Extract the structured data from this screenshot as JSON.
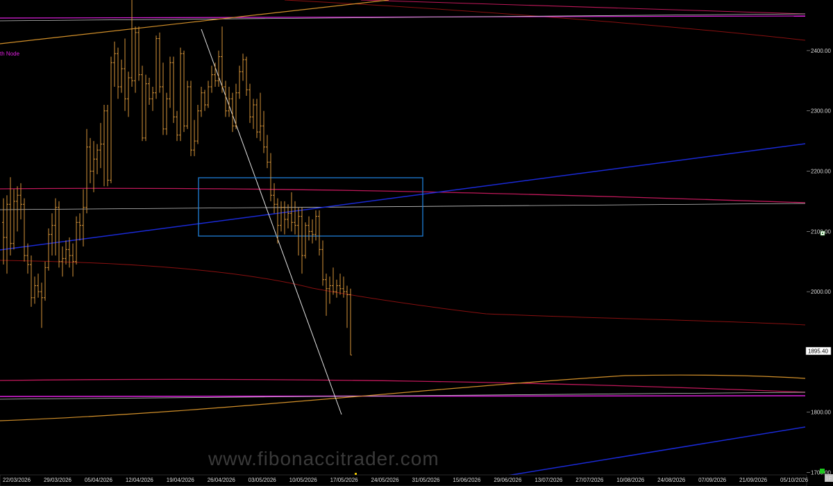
{
  "chart_data": {
    "type": "ohlc",
    "y_axis": {
      "ylim": [
        1696,
        2484
      ],
      "ticks": [
        "2400.00",
        "2300.00",
        "2200.00",
        "2100.00",
        "2000.00",
        "1900.00",
        "1800.00",
        "1700.00"
      ],
      "tick_values": [
        2400,
        2300,
        2200,
        2100,
        2000,
        1900,
        1800,
        1700
      ]
    },
    "x_axis": {
      "ticks": [
        "22/03/2026",
        "29/03/2026",
        "05/04/2026",
        "12/04/2026",
        "19/04/2026",
        "26/04/2026",
        "03/05/2026",
        "10/05/2026",
        "17/05/2026",
        "24/05/2026",
        "31/05/2026",
        "15/06/2026",
        "29/06/2026",
        "13/07/2026",
        "27/07/2026",
        "10/08/2026",
        "24/08/2026",
        "07/09/2026",
        "21/09/2026",
        "05/10/2026"
      ],
      "corner_label": "1F"
    },
    "last_price": "1895.40",
    "node_label": "th Node",
    "watermark": "www.fibonaccitrader.com",
    "colors": {
      "background": "#000000",
      "bars": "#d9963a",
      "price_tag_bg": "#ffffff",
      "grid_text": "#dcdcdc",
      "red_line": "#8a1010",
      "crimson_line": "#c0185a",
      "magenta_line": "#e020e0",
      "orange_line": "#d4912a",
      "blue_line": "#1a2ad8",
      "white_line": "#c8c8c8",
      "rectangle": "#1e7fd8"
    },
    "bars": [
      {
        "x": 5,
        "o": 2115,
        "h": 2155,
        "l": 2045,
        "c": 2090
      },
      {
        "x": 10,
        "o": 2090,
        "h": 2160,
        "l": 2030,
        "c": 2145
      },
      {
        "x": 15,
        "o": 2145,
        "h": 2190,
        "l": 2060,
        "c": 2080
      },
      {
        "x": 20,
        "o": 2080,
        "h": 2170,
        "l": 2070,
        "c": 2150
      },
      {
        "x": 25,
        "o": 2150,
        "h": 2175,
        "l": 2100,
        "c": 2160
      },
      {
        "x": 30,
        "o": 2160,
        "h": 2180,
        "l": 2120,
        "c": 2145
      },
      {
        "x": 35,
        "o": 2145,
        "h": 2155,
        "l": 2050,
        "c": 2060
      },
      {
        "x": 40,
        "o": 2060,
        "h": 2080,
        "l": 2030,
        "c": 2045
      },
      {
        "x": 45,
        "o": 2045,
        "h": 2060,
        "l": 1975,
        "c": 1990
      },
      {
        "x": 50,
        "o": 1990,
        "h": 2025,
        "l": 1980,
        "c": 2010
      },
      {
        "x": 55,
        "o": 2010,
        "h": 2030,
        "l": 1990,
        "c": 2000
      },
      {
        "x": 60,
        "o": 2000,
        "h": 2015,
        "l": 1940,
        "c": 1990
      },
      {
        "x": 65,
        "o": 1990,
        "h": 2050,
        "l": 1985,
        "c": 2040
      },
      {
        "x": 70,
        "o": 2040,
        "h": 2105,
        "l": 2035,
        "c": 2095
      },
      {
        "x": 75,
        "o": 2095,
        "h": 2130,
        "l": 2060,
        "c": 2110
      },
      {
        "x": 80,
        "o": 2110,
        "h": 2155,
        "l": 2060,
        "c": 2140
      },
      {
        "x": 85,
        "o": 2140,
        "h": 2150,
        "l": 2040,
        "c": 2050
      },
      {
        "x": 90,
        "o": 2050,
        "h": 2075,
        "l": 2025,
        "c": 2055
      },
      {
        "x": 95,
        "o": 2055,
        "h": 2085,
        "l": 2045,
        "c": 2070
      },
      {
        "x": 100,
        "o": 2070,
        "h": 2090,
        "l": 2040,
        "c": 2060
      },
      {
        "x": 105,
        "o": 2060,
        "h": 2080,
        "l": 2025,
        "c": 2050
      },
      {
        "x": 110,
        "o": 2050,
        "h": 2125,
        "l": 2045,
        "c": 2115
      },
      {
        "x": 115,
        "o": 2115,
        "h": 2130,
        "l": 2085,
        "c": 2110
      },
      {
        "x": 120,
        "o": 2110,
        "h": 2170,
        "l": 2075,
        "c": 2140
      },
      {
        "x": 125,
        "o": 2140,
        "h": 2270,
        "l": 2130,
        "c": 2240
      },
      {
        "x": 130,
        "o": 2240,
        "h": 2255,
        "l": 2180,
        "c": 2200
      },
      {
        "x": 135,
        "o": 2200,
        "h": 2250,
        "l": 2165,
        "c": 2220
      },
      {
        "x": 140,
        "o": 2220,
        "h": 2245,
        "l": 2195,
        "c": 2235
      },
      {
        "x": 145,
        "o": 2235,
        "h": 2280,
        "l": 2205,
        "c": 2245
      },
      {
        "x": 150,
        "o": 2245,
        "h": 2310,
        "l": 2175,
        "c": 2300
      },
      {
        "x": 155,
        "o": 2300,
        "h": 2310,
        "l": 2175,
        "c": 2185
      },
      {
        "x": 160,
        "o": 2185,
        "h": 2390,
        "l": 2180,
        "c": 2380
      },
      {
        "x": 165,
        "o": 2380,
        "h": 2415,
        "l": 2340,
        "c": 2395
      },
      {
        "x": 170,
        "o": 2395,
        "h": 2405,
        "l": 2320,
        "c": 2340
      },
      {
        "x": 175,
        "o": 2340,
        "h": 2385,
        "l": 2330,
        "c": 2370
      },
      {
        "x": 180,
        "o": 2370,
        "h": 2420,
        "l": 2300,
        "c": 2320
      },
      {
        "x": 185,
        "o": 2320,
        "h": 2365,
        "l": 2290,
        "c": 2355
      },
      {
        "x": 190,
        "o": 2355,
        "h": 2484,
        "l": 2340,
        "c": 2350
      },
      {
        "x": 195,
        "o": 2350,
        "h": 2440,
        "l": 2330,
        "c": 2430
      },
      {
        "x": 200,
        "o": 2430,
        "h": 2440,
        "l": 2350,
        "c": 2360
      },
      {
        "x": 205,
        "o": 2360,
        "h": 2375,
        "l": 2250,
        "c": 2255
      },
      {
        "x": 210,
        "o": 2255,
        "h": 2360,
        "l": 2250,
        "c": 2345
      },
      {
        "x": 215,
        "o": 2345,
        "h": 2355,
        "l": 2310,
        "c": 2320
      },
      {
        "x": 220,
        "o": 2320,
        "h": 2340,
        "l": 2300,
        "c": 2330
      },
      {
        "x": 225,
        "o": 2330,
        "h": 2425,
        "l": 2320,
        "c": 2420
      },
      {
        "x": 230,
        "o": 2420,
        "h": 2430,
        "l": 2330,
        "c": 2340
      },
      {
        "x": 235,
        "o": 2340,
        "h": 2380,
        "l": 2260,
        "c": 2270
      },
      {
        "x": 240,
        "o": 2270,
        "h": 2330,
        "l": 2260,
        "c": 2320
      },
      {
        "x": 245,
        "o": 2320,
        "h": 2390,
        "l": 2305,
        "c": 2380
      },
      {
        "x": 250,
        "o": 2380,
        "h": 2390,
        "l": 2280,
        "c": 2290
      },
      {
        "x": 255,
        "o": 2290,
        "h": 2300,
        "l": 2250,
        "c": 2260
      },
      {
        "x": 260,
        "o": 2260,
        "h": 2405,
        "l": 2250,
        "c": 2395
      },
      {
        "x": 265,
        "o": 2395,
        "h": 2400,
        "l": 2265,
        "c": 2275
      },
      {
        "x": 270,
        "o": 2275,
        "h": 2350,
        "l": 2270,
        "c": 2340
      },
      {
        "x": 275,
        "o": 2340,
        "h": 2350,
        "l": 2225,
        "c": 2235
      },
      {
        "x": 280,
        "o": 2235,
        "h": 2285,
        "l": 2225,
        "c": 2250
      },
      {
        "x": 285,
        "o": 2250,
        "h": 2310,
        "l": 2245,
        "c": 2300
      },
      {
        "x": 290,
        "o": 2300,
        "h": 2340,
        "l": 2290,
        "c": 2330
      },
      {
        "x": 295,
        "o": 2330,
        "h": 2335,
        "l": 2300,
        "c": 2310
      },
      {
        "x": 300,
        "o": 2310,
        "h": 2350,
        "l": 2305,
        "c": 2340
      },
      {
        "x": 305,
        "o": 2340,
        "h": 2375,
        "l": 2330,
        "c": 2360
      },
      {
        "x": 310,
        "o": 2360,
        "h": 2380,
        "l": 2340,
        "c": 2350
      },
      {
        "x": 315,
        "o": 2350,
        "h": 2400,
        "l": 2340,
        "c": 2390
      },
      {
        "x": 320,
        "o": 2390,
        "h": 2440,
        "l": 2330,
        "c": 2340
      },
      {
        "x": 325,
        "o": 2340,
        "h": 2350,
        "l": 2290,
        "c": 2300
      },
      {
        "x": 330,
        "o": 2300,
        "h": 2340,
        "l": 2290,
        "c": 2320
      },
      {
        "x": 335,
        "o": 2320,
        "h": 2330,
        "l": 2265,
        "c": 2275
      },
      {
        "x": 340,
        "o": 2275,
        "h": 2345,
        "l": 2270,
        "c": 2330
      },
      {
        "x": 345,
        "o": 2330,
        "h": 2375,
        "l": 2320,
        "c": 2365
      },
      {
        "x": 350,
        "o": 2365,
        "h": 2395,
        "l": 2350,
        "c": 2385
      },
      {
        "x": 355,
        "o": 2385,
        "h": 2390,
        "l": 2325,
        "c": 2335
      },
      {
        "x": 360,
        "o": 2335,
        "h": 2345,
        "l": 2280,
        "c": 2290
      },
      {
        "x": 365,
        "o": 2290,
        "h": 2320,
        "l": 2270,
        "c": 2310
      },
      {
        "x": 370,
        "o": 2310,
        "h": 2320,
        "l": 2255,
        "c": 2265
      },
      {
        "x": 375,
        "o": 2265,
        "h": 2330,
        "l": 2250,
        "c": 2275
      },
      {
        "x": 380,
        "o": 2275,
        "h": 2300,
        "l": 2230,
        "c": 2240
      },
      {
        "x": 385,
        "o": 2240,
        "h": 2260,
        "l": 2205,
        "c": 2215
      },
      {
        "x": 390,
        "o": 2215,
        "h": 2230,
        "l": 2150,
        "c": 2160
      },
      {
        "x": 395,
        "o": 2160,
        "h": 2180,
        "l": 2130,
        "c": 2145
      },
      {
        "x": 400,
        "o": 2145,
        "h": 2155,
        "l": 2080,
        "c": 2110
      },
      {
        "x": 405,
        "o": 2110,
        "h": 2150,
        "l": 2100,
        "c": 2140
      },
      {
        "x": 410,
        "o": 2140,
        "h": 2150,
        "l": 2095,
        "c": 2120
      },
      {
        "x": 415,
        "o": 2120,
        "h": 2145,
        "l": 2105,
        "c": 2130
      },
      {
        "x": 420,
        "o": 2130,
        "h": 2165,
        "l": 2100,
        "c": 2115
      },
      {
        "x": 425,
        "o": 2115,
        "h": 2150,
        "l": 2095,
        "c": 2110
      },
      {
        "x": 430,
        "o": 2110,
        "h": 2140,
        "l": 2060,
        "c": 2125
      },
      {
        "x": 435,
        "o": 2125,
        "h": 2140,
        "l": 2030,
        "c": 2060
      },
      {
        "x": 440,
        "o": 2060,
        "h": 2115,
        "l": 2055,
        "c": 2110
      },
      {
        "x": 445,
        "o": 2110,
        "h": 2125,
        "l": 2085,
        "c": 2100
      },
      {
        "x": 450,
        "o": 2100,
        "h": 2120,
        "l": 2080,
        "c": 2095
      },
      {
        "x": 455,
        "o": 2095,
        "h": 2135,
        "l": 2085,
        "c": 2125
      },
      {
        "x": 460,
        "o": 2125,
        "h": 2135,
        "l": 2060,
        "c": 2070
      },
      {
        "x": 465,
        "o": 2070,
        "h": 2085,
        "l": 2010,
        "c": 2020
      },
      {
        "x": 470,
        "o": 2020,
        "h": 2030,
        "l": 1960,
        "c": 2005
      },
      {
        "x": 475,
        "o": 2005,
        "h": 2025,
        "l": 1980,
        "c": 2010
      },
      {
        "x": 480,
        "o": 2010,
        "h": 2040,
        "l": 1995,
        "c": 2000
      },
      {
        "x": 485,
        "o": 2000,
        "h": 2020,
        "l": 1990,
        "c": 2010
      },
      {
        "x": 490,
        "o": 2010,
        "h": 2030,
        "l": 1995,
        "c": 2005
      },
      {
        "x": 495,
        "o": 2005,
        "h": 2025,
        "l": 1990,
        "c": 2000
      },
      {
        "x": 500,
        "o": 2000,
        "h": 2010,
        "l": 1940,
        "c": 1995
      },
      {
        "x": 505,
        "o": 1995,
        "h": 2005,
        "l": 1895,
        "c": 1895
      }
    ]
  }
}
